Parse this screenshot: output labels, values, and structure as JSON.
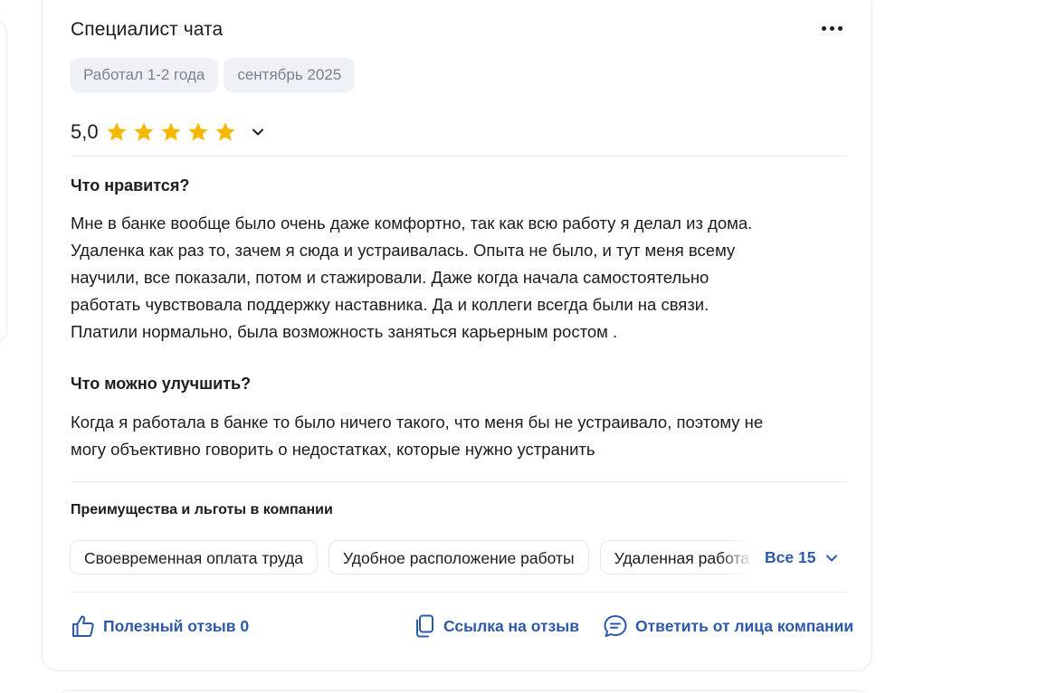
{
  "review": {
    "title": "Специалист чата",
    "tags": [
      "Работал 1-2 года",
      "сентябрь 2025"
    ],
    "rating": {
      "value_text": "5,0",
      "stars_filled": 5,
      "stars_total": 5,
      "star_color": "#f5b800"
    },
    "likes": {
      "heading": "Что нравится?",
      "lines": [
        "Мне в банке вообще было очень даже комфортно, так как всю работу я делал из дома.",
        "Удаленка как раз то, зачем я сюда и устраивалась. Опыта не было, и тут меня всему",
        "научили, все показали, потом и стажировали. Даже когда начала самостоятельно",
        "работать чувствовала поддержку наставника. Да и коллеги всегда были на связи.",
        "Платили нормально, была возможность заняться карьерным ростом ."
      ]
    },
    "improve": {
      "heading": "Что можно улучшить?",
      "lines": [
        "Когда я работала в банке то было ничего такого, что меня бы не устраивало, поэтому не",
        "могу объективно говорить о недостатках, которые нужно устранить"
      ]
    },
    "benefits": {
      "heading": "Преимущества и льготы в компании",
      "chips": [
        "Своевременная оплата труда",
        "Удобное расположение работы",
        "Удаленная работа"
      ],
      "all_label": "Все 15"
    },
    "actions": {
      "helpful_label": "Полезный отзыв 0",
      "link_label": "Ссылка на отзыв",
      "reply_label": "Ответить от лица компании"
    }
  },
  "colors": {
    "link_blue": "#2d5aa8",
    "tag_bg": "#eef1f6",
    "tag_text": "#7a8090",
    "border": "#e6e8ee"
  },
  "icons": [
    "more-dots-icon",
    "star-icon",
    "chevron-down-icon",
    "thumbs-up-icon",
    "copy-link-icon",
    "chat-reply-icon"
  ]
}
